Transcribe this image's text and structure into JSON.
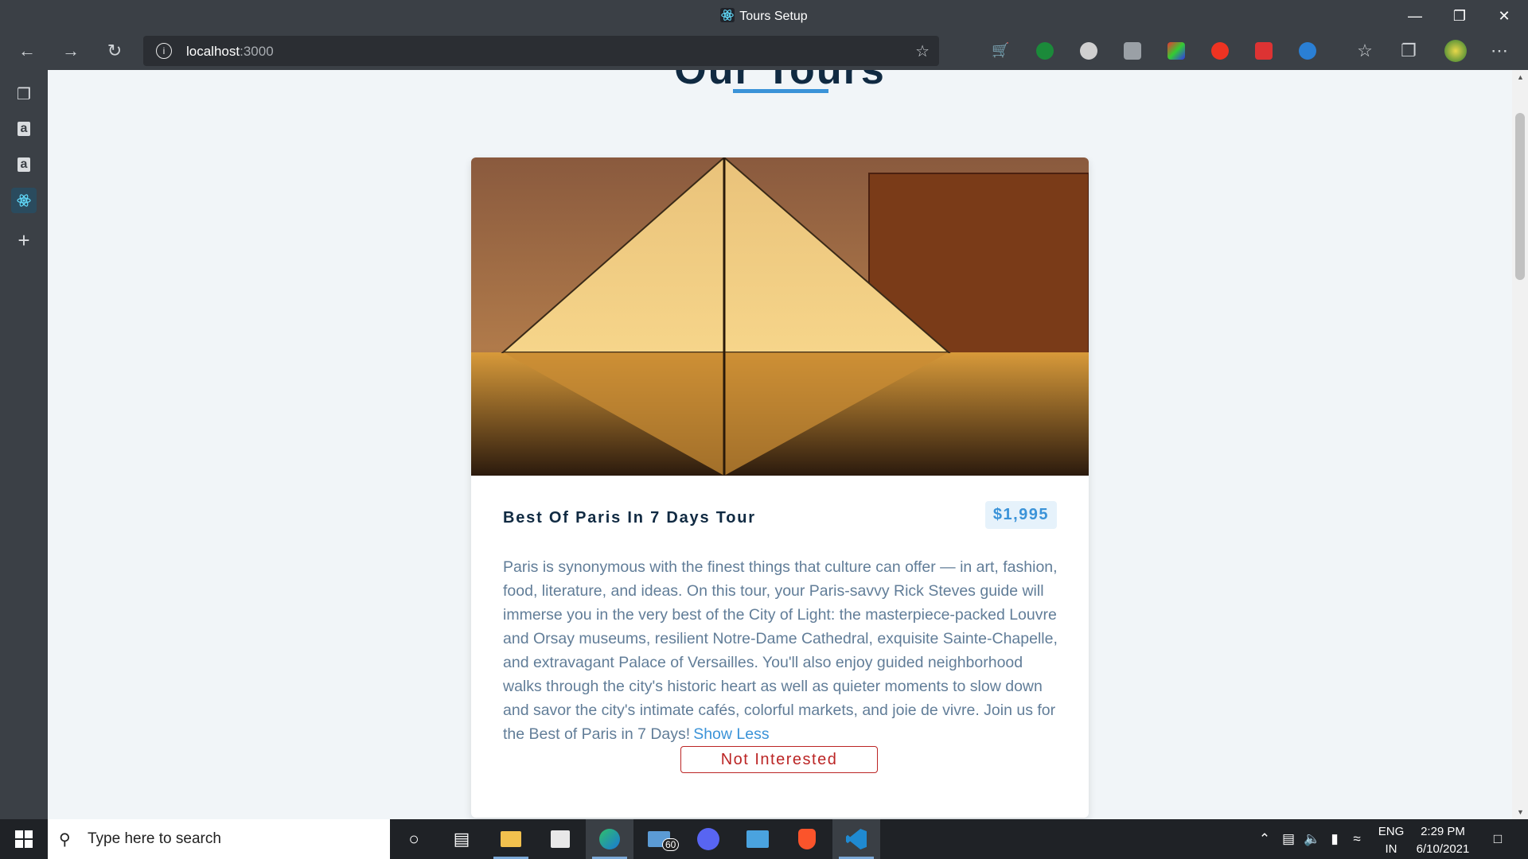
{
  "window": {
    "title": "Tours Setup",
    "controls": [
      "minimize",
      "restore",
      "close"
    ]
  },
  "toolbar": {
    "url_host": "localhost",
    "url_port": ":3000"
  },
  "page": {
    "section_title": "Our Tours",
    "tour": {
      "name": "Best Of Paris In 7 Days Tour",
      "price": "$1,995",
      "info": "Paris is synonymous with the finest things that culture can offer — in art, fashion, food, literature, and ideas. On this tour, your Paris-savvy Rick Steves guide will immerse you in the very best of the City of Light: the masterpiece-packed Louvre and Orsay museums, resilient Notre-Dame Cathedral, exquisite Sainte-Chapelle, and extravagant Palace of Versailles. You'll also enjoy guided neighborhood walks through the city's historic heart as well as quieter moments to slow down and savor the city's intimate cafés, colorful markets, and joie de vivre. Join us for the Best of Paris in 7 Days!",
      "toggle_label": "Show Less",
      "button_label": "Not Interested"
    }
  },
  "taskbar": {
    "search_placeholder": "Type here to search",
    "mail_badge": "60",
    "lang_line1": "ENG",
    "lang_line2": "IN",
    "time": "2:29 PM",
    "date": "6/10/2021"
  },
  "colors": {
    "accent": "#3b93d8",
    "danger": "#bb2525",
    "heading": "#102a42",
    "body_text": "#617d98",
    "chrome": "#3b4046"
  }
}
